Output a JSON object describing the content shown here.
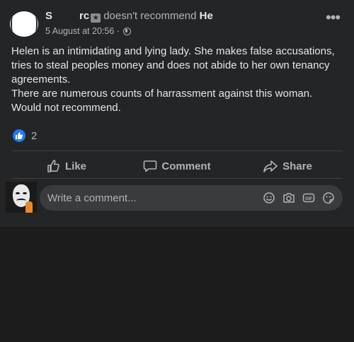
{
  "post": {
    "author_initial": "S",
    "author_fragment": "rc",
    "verb": "doesn't recommend",
    "target_fragment": "He",
    "timestamp": "5 August at 20:56",
    "separator": "·",
    "more_label": "•••",
    "text_lines": [
      "Helen is an intimidating and lying lady. She makes false accusations, tries to steal peoples money and does not abide to her own tenancy agreements.",
      "There are numerous counts of harrassment against this woman.",
      "Would not recommend."
    ],
    "reaction_count": "2"
  },
  "actions": {
    "like": "Like",
    "comment": "Comment",
    "share": "Share"
  },
  "comment_box": {
    "placeholder": "Write a comment..."
  },
  "colors": {
    "card": "#242526",
    "page": "#1c1c1d",
    "text_primary": "#e4e6eb",
    "text_secondary": "#b0b3b8",
    "like_blue": "#2078f4",
    "input_bg": "#3a3b3c"
  },
  "icons": [
    "globe-icon",
    "more-options-icon",
    "like-reaction-icon",
    "thumbs-up-icon",
    "comment-icon",
    "share-icon",
    "emoji-icon",
    "camera-icon",
    "gif-icon",
    "sticker-icon"
  ]
}
